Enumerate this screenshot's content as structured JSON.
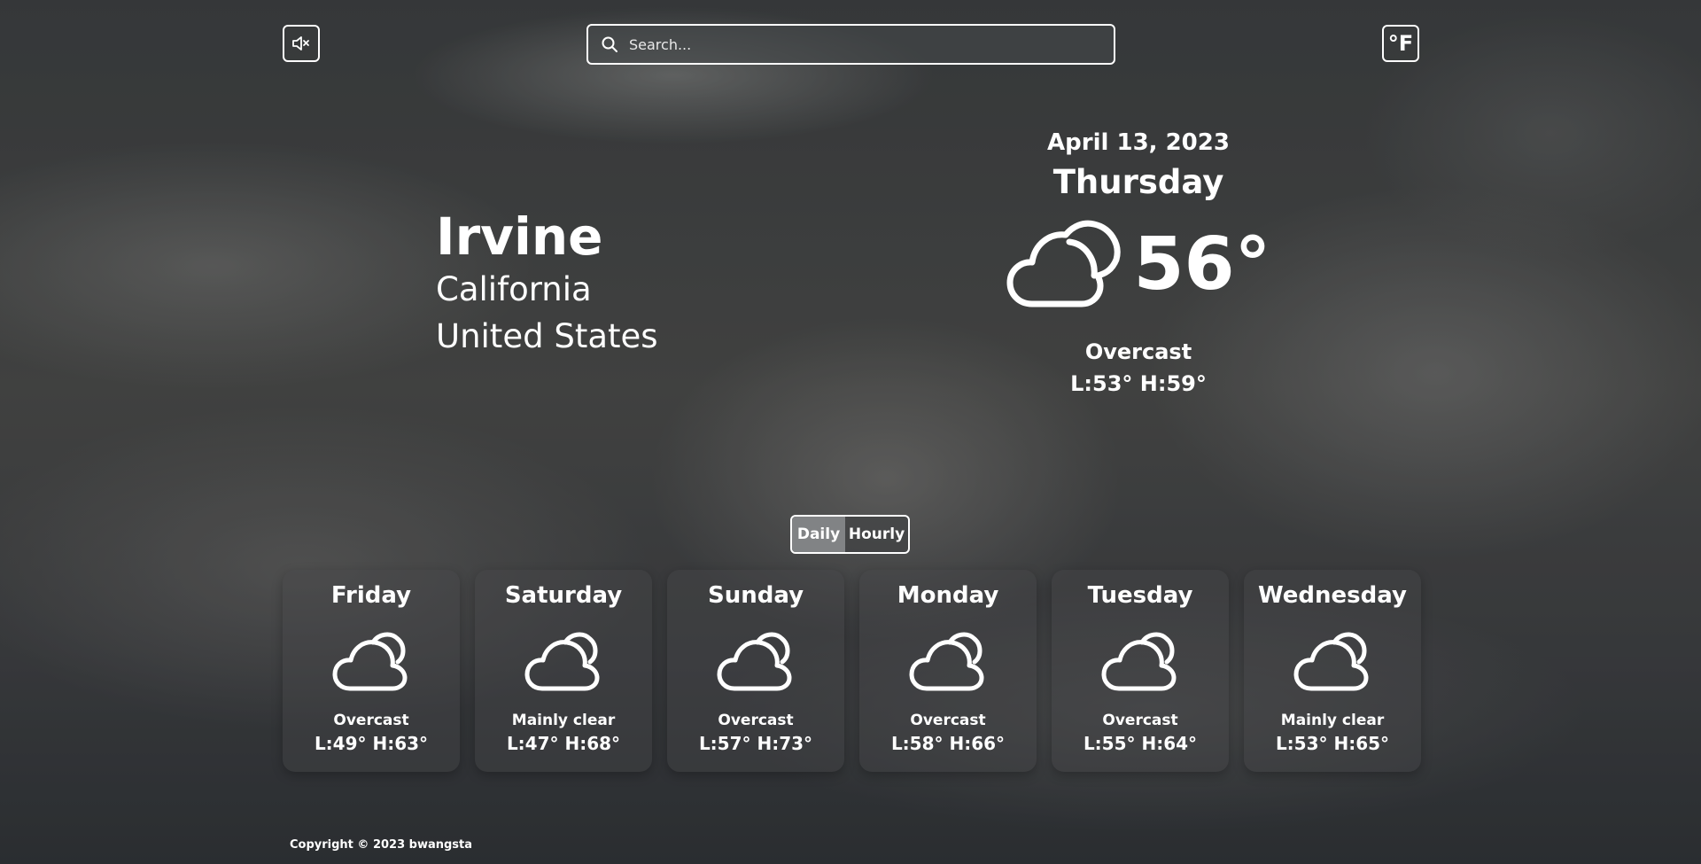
{
  "header": {
    "mute_icon": "speaker-muted-icon",
    "search_placeholder": "Search...",
    "search_value": "",
    "unit_label": "°F"
  },
  "location": {
    "city": "Irvine",
    "region": "California",
    "country": "United States"
  },
  "current": {
    "date": "April 13, 2023",
    "weekday": "Thursday",
    "icon": "cloud-icon",
    "temperature": "56°",
    "condition": "Overcast",
    "hi_lo": "L:53° H:59°"
  },
  "view_toggle": {
    "options": [
      "Daily",
      "Hourly"
    ],
    "selected": "Daily"
  },
  "forecast": [
    {
      "day": "Friday",
      "icon": "partly-cloudy-icon",
      "condition": "Overcast",
      "hi_lo": "L:49°  H:63°"
    },
    {
      "day": "Saturday",
      "icon": "partly-cloudy-icon",
      "condition": "Mainly clear",
      "hi_lo": "L:47°  H:68°"
    },
    {
      "day": "Sunday",
      "icon": "partly-cloudy-icon",
      "condition": "Overcast",
      "hi_lo": "L:57°  H:73°"
    },
    {
      "day": "Monday",
      "icon": "partly-cloudy-icon",
      "condition": "Overcast",
      "hi_lo": "L:58°  H:66°"
    },
    {
      "day": "Tuesday",
      "icon": "partly-cloudy-icon",
      "condition": "Overcast",
      "hi_lo": "L:55°  H:64°"
    },
    {
      "day": "Wednesday",
      "icon": "partly-cloudy-icon",
      "condition": "Mainly clear",
      "hi_lo": "L:53°  H:65°"
    }
  ],
  "footer": {
    "copyright": "Copyright © 2023 bwangsta"
  }
}
